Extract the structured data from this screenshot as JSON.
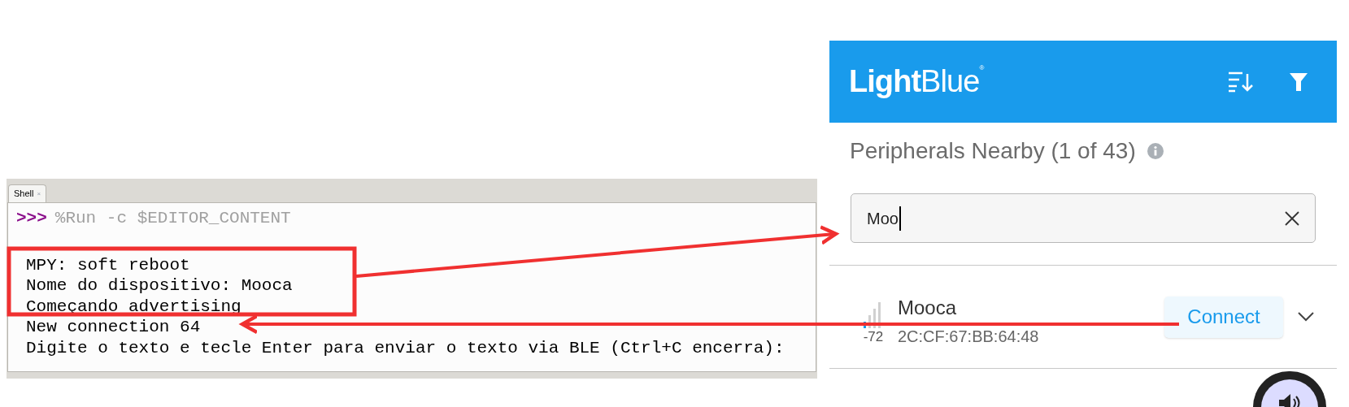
{
  "shell": {
    "tab": "Shell",
    "tab_close": "×",
    "prompt": ">>>",
    "command": "%Run -c $EDITOR_CONTENT",
    "output": [
      "MPY: soft reboot",
      "Nome do dispositivo: Mooca",
      "Começando advertising",
      "New connection 64",
      "Digite o texto e tecle Enter para enviar o texto via BLE (Ctrl+C encerra):"
    ]
  },
  "app": {
    "logo_bold": "Light",
    "logo_light": "Blue",
    "logo_mark": "®",
    "title": "Peripherals Nearby (1 of 43)",
    "search": {
      "value": "Moo"
    },
    "devices": [
      {
        "name": "Mooca",
        "address": "2C:CF:67:BB:64:48",
        "rssi": "-72",
        "action": "Connect"
      }
    ]
  }
}
